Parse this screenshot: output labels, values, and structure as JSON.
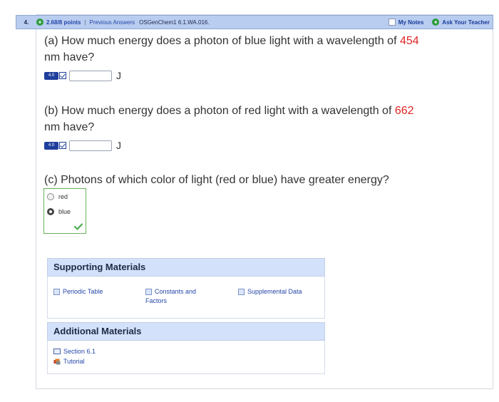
{
  "header": {
    "question_number": "4.",
    "points": "2.68/8 points",
    "separator": "|",
    "previous_answers": "Previous Answers",
    "assignment_id": "OSGenChem1 6.1.WA.016.",
    "my_notes": "My Notes",
    "ask_teacher": "Ask Your Teacher"
  },
  "parts": {
    "a": {
      "text_before": "(a) How much energy does a photon of blue light with a wavelength of ",
      "value": "454",
      "text_after": "nm have?",
      "badge": "4.0",
      "input_value": "",
      "unit": "J"
    },
    "b": {
      "text_before": "(b) How much energy does a photon of red light with a wavelength of ",
      "value": "662",
      "text_after": "nm have?",
      "badge": "4.0",
      "input_value": "",
      "unit": "J"
    },
    "c": {
      "text": "(c) Photons of which color of light (red or blue) have greater energy?",
      "options": [
        "red",
        "blue"
      ],
      "selected": "blue"
    }
  },
  "supporting": {
    "title": "Supporting Materials",
    "links": [
      "Periodic Table",
      "Constants and Factors",
      "Supplemental Data"
    ]
  },
  "additional": {
    "title": "Additional Materials",
    "links": [
      "Section 6.1",
      "Tutorial"
    ]
  },
  "colors": {
    "header_bg": "#b9cdf0",
    "highlight_red": "#e02424",
    "link_blue": "#2447a8",
    "panel_head": "#d4e1fa",
    "correct_green": "#4caf50"
  }
}
